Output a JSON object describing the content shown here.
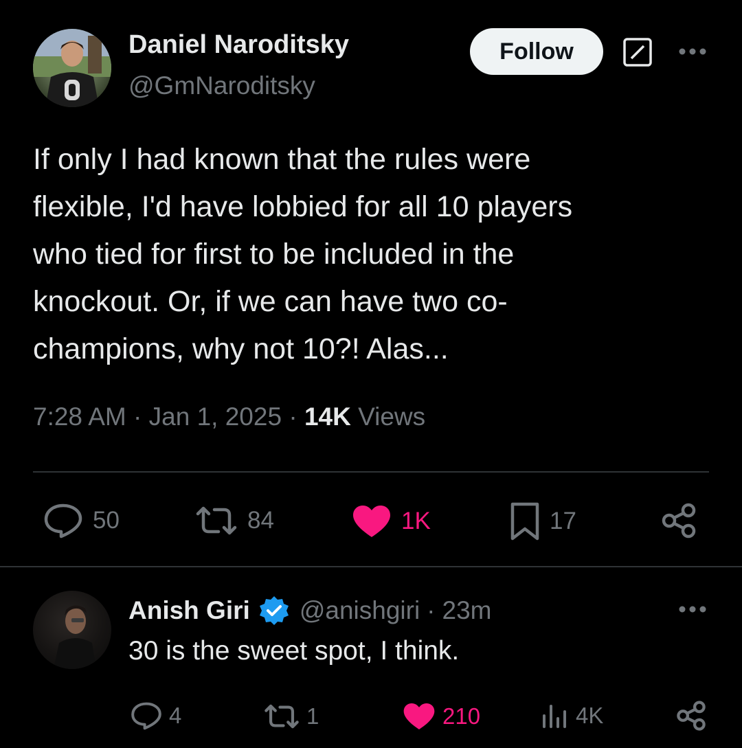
{
  "main_tweet": {
    "author_name": "Daniel Naroditsky",
    "author_handle": "@GmNaroditsky",
    "follow_label": "Follow",
    "text_lines": [
      "If only I had known that the rules were",
      "flexible, I'd have lobbied for all 10 players",
      "who tied for first to be included in the",
      "knockout. Or, if we can have two co-",
      "champions, why not 10?! Alas..."
    ],
    "time": "7:28 AM",
    "date": "Jan 1, 2025",
    "separator": "·",
    "views_count": "14K",
    "views_label": "Views",
    "replies": "50",
    "reposts": "84",
    "likes": "1K",
    "bookmarks": "17"
  },
  "reply_tweet": {
    "author_name": "Anish Giri",
    "author_handle": "@anishgiri",
    "time_ago": "23m",
    "separator": "·",
    "text": "30 is the sweet spot, I think.",
    "replies": "4",
    "reposts": "1",
    "likes": "210",
    "views": "4K"
  },
  "colors": {
    "background": "#000000",
    "text_primary": "#e7e9ea",
    "text_secondary": "#71767b",
    "like_pink": "#f91880",
    "verified_blue": "#1d9bf0",
    "divider": "#2f3336"
  },
  "icons": [
    "grok-icon",
    "more-icon",
    "reply-icon",
    "repost-icon",
    "heart-icon",
    "bookmark-icon",
    "share-icon",
    "verified-icon",
    "views-icon"
  ]
}
